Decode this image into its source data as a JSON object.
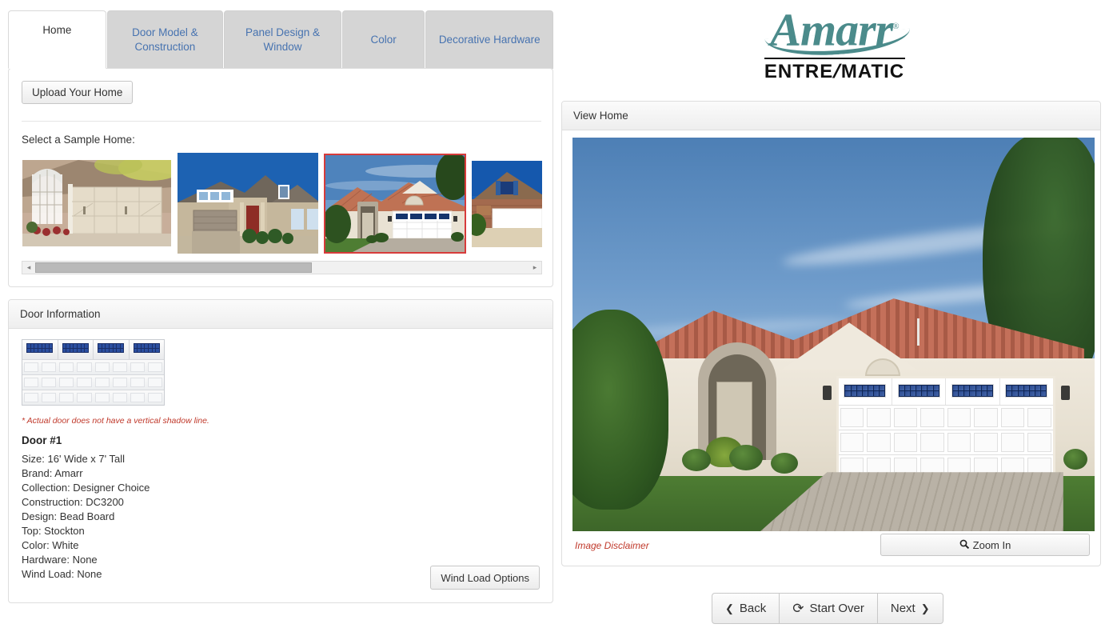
{
  "tabs": [
    {
      "id": "home",
      "label": "Home",
      "active": true
    },
    {
      "id": "model",
      "label": "Door Model & Construction",
      "active": false
    },
    {
      "id": "panel",
      "label": "Panel Design & Window",
      "active": false
    },
    {
      "id": "color",
      "label": "Color",
      "active": false
    },
    {
      "id": "hardware",
      "label": "Decorative Hardware",
      "active": false
    }
  ],
  "tab_labels": {
    "home": "Home",
    "model_line1": "Door Model &",
    "model_line2": "Construction",
    "panel_line1": "Panel Design &",
    "panel_line2": "Window",
    "color": "Color",
    "hardware": "Decorative Hardware"
  },
  "home_panel": {
    "upload_button": "Upload Your Home",
    "select_label": "Select a Sample Home:",
    "thumbnails": [
      {
        "name": "brick-home-carriage-door",
        "selected": false
      },
      {
        "name": "two-story-tan-home",
        "selected": false
      },
      {
        "name": "spanish-tile-stucco-home",
        "selected": true
      },
      {
        "name": "brick-home-blue-shutters",
        "selected": false
      }
    ],
    "scroll_left_arrow": "◂",
    "scroll_right_arrow": "▸"
  },
  "door_info": {
    "header": "Door Information",
    "note": "* Actual door does not have a vertical shadow line.",
    "title": "Door #1",
    "specs": [
      {
        "label": "Size:",
        "value": "16' Wide x 7' Tall"
      },
      {
        "label": "Brand:",
        "value": "Amarr"
      },
      {
        "label": "Collection:",
        "value": "Designer Choice"
      },
      {
        "label": "Construction:",
        "value": "DC3200"
      },
      {
        "label": "Design:",
        "value": "Bead Board"
      },
      {
        "label": "Top:",
        "value": "Stockton"
      },
      {
        "label": "Color:",
        "value": "White"
      },
      {
        "label": "Hardware:",
        "value": "None"
      },
      {
        "label": "Wind Load:",
        "value": "None"
      }
    ],
    "spec_lines": [
      "Size: 16' Wide x 7' Tall",
      "Brand: Amarr",
      "Collection: Designer Choice",
      "Construction: DC3200",
      "Design: Bead Board",
      "Top: Stockton",
      "Color: White",
      "Hardware: None",
      "Wind Load: None"
    ],
    "wind_load_button": "Wind Load Options"
  },
  "logo": {
    "brand": "Amarr",
    "registered": "®",
    "subbrand_part1": "ENTRE",
    "subbrand_slash": "/",
    "subbrand_part2": "MATIC"
  },
  "view_panel": {
    "header": "View Home",
    "image_alt": "spanish-tile-stucco-home-with-white-garage-door",
    "disclaimer": "Image Disclaimer",
    "zoom_button": "Zoom In",
    "zoom_icon": "🔍"
  },
  "nav": {
    "back": "Back",
    "start_over": "Start Over",
    "next": "Next",
    "back_icon": "❮",
    "refresh_icon": "⟳",
    "next_icon": "❯"
  },
  "colors": {
    "tab_link": "#4773b0",
    "selected_thumb_border": "#d73b3b",
    "disclaimer_red": "#c0392b",
    "logo_teal": "#4b8b8b",
    "panel_border": "#dedede"
  }
}
